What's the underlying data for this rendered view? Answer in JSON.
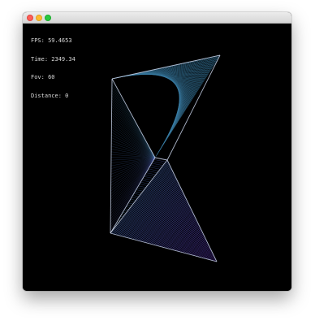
{
  "hud": {
    "fps": "FPS: 59.4653",
    "time": "Time: 2349.34",
    "fov": "Fov: 60",
    "distance": "Distance: 0"
  },
  "colors": {
    "window_background": "#000000",
    "shape_top": "#3b7fa8",
    "shape_bottom": "#6a3cd0",
    "edge": "#c9d3ea"
  }
}
